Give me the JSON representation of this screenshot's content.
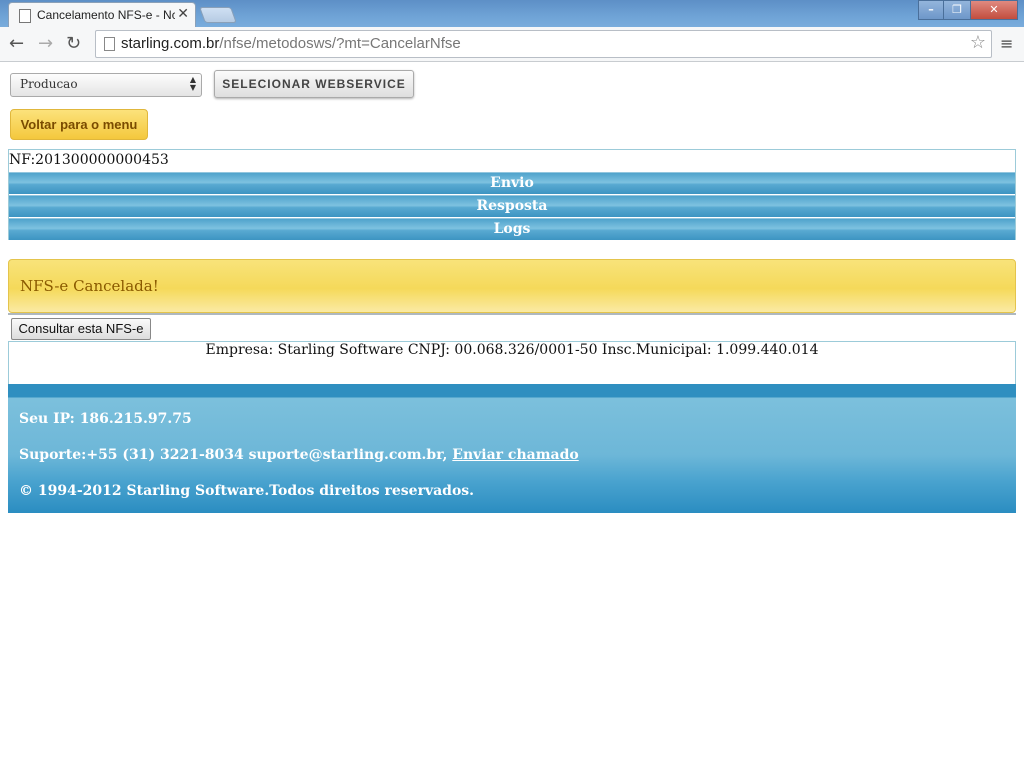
{
  "browser": {
    "tab_title": "Cancelamento NFS-e - Nc",
    "tab_close": "✕",
    "url_host": "starling.com.br",
    "url_path": "/nfse/metodosws/?mt=CancelarNfse"
  },
  "controls": {
    "environment_selected": "Producao",
    "select_webservice_label": "SELECIONAR WEBSERVICE",
    "back_label": "Voltar para o menu"
  },
  "panel": {
    "nf_label": "NF:201300000000453",
    "sections": [
      "Envio",
      "Resposta",
      "Logs"
    ]
  },
  "alert": {
    "message": "NFS-e Cancelada!"
  },
  "consult_button_label": "Consultar esta NFS-e",
  "company_info": "Empresa: Starling Software CNPJ: 00.068.326/0001-50 Insc.Municipal: 1.099.440.014",
  "footer": {
    "ip_text": "Seu IP: 186.215.97.75",
    "support_text": "Suporte:+55 (31) 3221-8034 suporte@starling.com.br,",
    "support_link": "Enviar chamado",
    "copyright": "© 1994-2012 Starling Software.Todos direitos reservados."
  },
  "colors": {
    "accent_blue": "#4fa3cc",
    "alert_yellow": "#f5d95a",
    "button_yellow": "#f4c83d"
  }
}
